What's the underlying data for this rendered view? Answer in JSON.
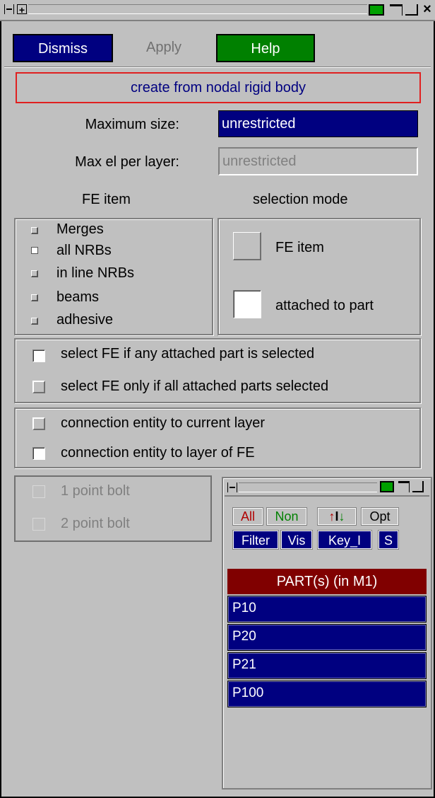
{
  "titlebar": {
    "icon_minus": "minus-icon",
    "icon_move": "move-icon",
    "icon_maximize": "maximize-icon",
    "icon_restore": "restore-icon",
    "icon_close": "close-icon",
    "close_glyph": "×"
  },
  "toolbar": {
    "dismiss": "Dismiss",
    "apply": "Apply",
    "help": "Help",
    "colors": {
      "dismiss_bg": "#000080",
      "help_bg": "#008000"
    }
  },
  "banner": {
    "text": "create from nodal rigid body",
    "border_color": "#e02020"
  },
  "fields": {
    "max_size": {
      "label": "Maximum size:",
      "value": "unrestricted"
    },
    "max_el": {
      "label": "Max el per layer:",
      "value": "unrestricted"
    }
  },
  "headers": {
    "fe_item": "FE item",
    "selection_mode": "selection mode"
  },
  "fe_items": [
    "Merges",
    "all NRBs",
    "in line NRBs",
    "beams",
    "adhesive"
  ],
  "fe_selected_index": 1,
  "selection_mode": {
    "fe_item": "FE item",
    "attached": "attached to part"
  },
  "select_options": {
    "any": "select FE if any attached part is selected",
    "all": "select FE only if all attached parts selected"
  },
  "connection_options": {
    "current": "connection entity to current layer",
    "fe": "connection entity to layer of FE"
  },
  "bolts": {
    "one": "1 point bolt",
    "two": "2 point bolt"
  },
  "part_panel": {
    "buttons": {
      "all": "All",
      "non": "Non",
      "sort": "↑↓",
      "opt": "Opt",
      "filter": "Filter",
      "vis": "Vis",
      "key": "Key_I",
      "s": "S"
    },
    "header": "PART(s) (in M1)",
    "header_color": "#800000",
    "rows": [
      "P10",
      "P20",
      "P21",
      "P100"
    ]
  }
}
